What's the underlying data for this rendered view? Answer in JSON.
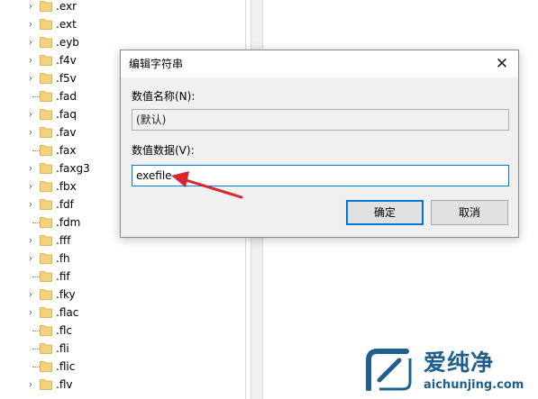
{
  "tree": {
    "items": [
      {
        "label": ".exr",
        "expandable": true
      },
      {
        "label": ".ext",
        "expandable": true
      },
      {
        "label": ".eyb",
        "expandable": true
      },
      {
        "label": ".f4v",
        "expandable": true
      },
      {
        "label": ".f5v",
        "expandable": true
      },
      {
        "label": ".fad",
        "expandable": false
      },
      {
        "label": ".faq",
        "expandable": true
      },
      {
        "label": ".fav",
        "expandable": true
      },
      {
        "label": ".fax",
        "expandable": false
      },
      {
        "label": ".faxg3",
        "expandable": true
      },
      {
        "label": ".fbx",
        "expandable": true
      },
      {
        "label": ".fdf",
        "expandable": true
      },
      {
        "label": ".fdm",
        "expandable": false
      },
      {
        "label": ".fff",
        "expandable": true
      },
      {
        "label": ".fh",
        "expandable": true
      },
      {
        "label": ".fif",
        "expandable": false
      },
      {
        "label": ".fky",
        "expandable": true
      },
      {
        "label": ".flac",
        "expandable": true
      },
      {
        "label": ".flc",
        "expandable": false
      },
      {
        "label": ".fli",
        "expandable": false
      },
      {
        "label": ".flic",
        "expandable": false
      },
      {
        "label": ".flv",
        "expandable": true
      }
    ]
  },
  "dialog": {
    "title": "编辑字符串",
    "value_name_label": "数值名称(N):",
    "value_name": "(默认)",
    "value_data_label": "数值数据(V):",
    "value_data": "exefile",
    "ok_label": "确定",
    "cancel_label": "取消"
  },
  "annotation": {
    "arrow_color": "#d7282f"
  },
  "watermark": {
    "text_cn": "爱纯净",
    "url": "aichunjing.com",
    "color": "#1f5f8b"
  },
  "colors": {
    "folder": "#f2d27a",
    "accent": "#0078d7"
  }
}
